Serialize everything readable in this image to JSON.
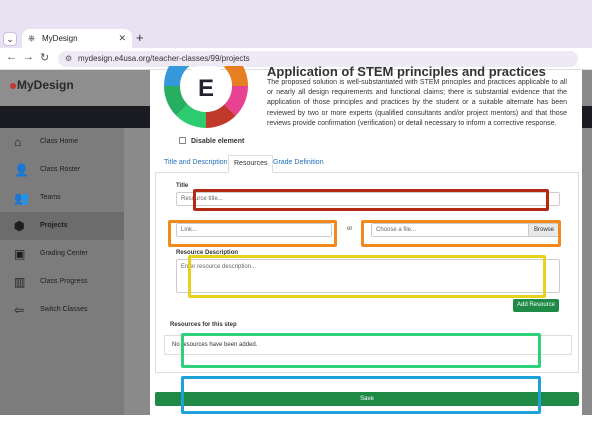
{
  "browser": {
    "tab_title": "MyDesign",
    "url": "mydesign.e4usa.org/teacher-classes/99/projects"
  },
  "logo_text": "MyDesign",
  "sidebar": {
    "items": [
      {
        "label": "Class Home",
        "icon": "home-icon",
        "glyph": "⌂"
      },
      {
        "label": "Class Roster",
        "icon": "user-icon",
        "glyph": "👤"
      },
      {
        "label": "Teams",
        "icon": "team-icon",
        "glyph": "👥"
      },
      {
        "label": "Projects",
        "icon": "cube-icon",
        "glyph": "⬢"
      },
      {
        "label": "Grading Center",
        "icon": "book-icon",
        "glyph": "▣"
      },
      {
        "label": "Class Progress",
        "icon": "chart-icon",
        "glyph": "▥"
      },
      {
        "label": "Switch Classes",
        "icon": "arrow-left-icon",
        "glyph": "⇦"
      }
    ],
    "active": "Projects"
  },
  "modal": {
    "heading": "Application of STEM principles and practices",
    "wheel_letter": "E",
    "description": "The proposed solution is well-substantiated with STEM principles and practices applicable to all or nearly all design requirements and functional claims; there is substantial evidence that the application of those principles and practices by the student or a suitable alternate has been reviewed by two or more experts (qualified consultants and/or project mentors) and that those reviews provide confirmation (verification) or detail necessary to inform a corrective response.",
    "disable_label": "Disable element",
    "tabs": [
      "Title and Description",
      "Resources",
      "Grade Definition"
    ],
    "active_tab": "Resources",
    "resources": {
      "title_label": "Title",
      "title_placeholder": "Resource title...",
      "link_placeholder": "Link...",
      "or_label": "or",
      "file_placeholder": "Choose a file...",
      "browse_label": "Browse",
      "description_label": "Resource Description",
      "description_placeholder": "Enter resource description...",
      "add_button": "Add Resource",
      "list_title": "Resources for this step",
      "empty_text": "No resources have been added."
    },
    "save_button": "Save"
  },
  "colors": {
    "accent_green": "#1e8a46",
    "highlight_red": "#b22a14",
    "highlight_orange": "#f08a1c",
    "highlight_yellow": "#e6d21e",
    "highlight_green": "#2ed07a",
    "highlight_blue": "#1ea0d8"
  }
}
